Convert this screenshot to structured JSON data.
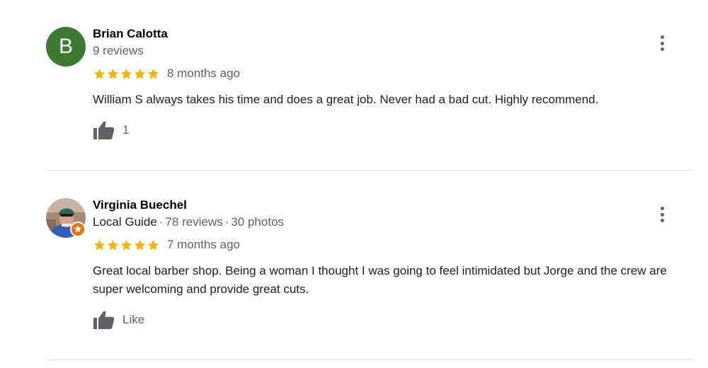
{
  "reviews": [
    {
      "avatar_letter": "B",
      "avatar_color": "#3c7a32",
      "name": "Brian Calotta",
      "reviews_count": "9 reviews",
      "rating": 5,
      "time": "8 months ago",
      "text": "William S always takes his time and does a great job.  Never had a bad cut. Highly recommend.",
      "like_label": "1"
    },
    {
      "avatar_icon": "profile-photo",
      "badge_icon": "local-guide-badge-icon",
      "name": "Virginia Buechel",
      "local_guide": "Local Guide",
      "reviews_count": "78 reviews",
      "photos_count": "30 photos",
      "separator": "·",
      "rating": 5,
      "time": "7 months ago",
      "text": "Great local barber shop. Being a woman I thought I was going to feel intimidated but Jorge and the crew are super welcoming and provide great cuts.",
      "like_label": "Like"
    }
  ],
  "colors": {
    "star": "#f4b400",
    "muted": "#5f6368",
    "text": "#202124",
    "guide_badge": "#e8710a"
  },
  "icons": {
    "star": "star-icon",
    "thumb": "thumbs-up-icon",
    "more": "more-vert-icon"
  }
}
